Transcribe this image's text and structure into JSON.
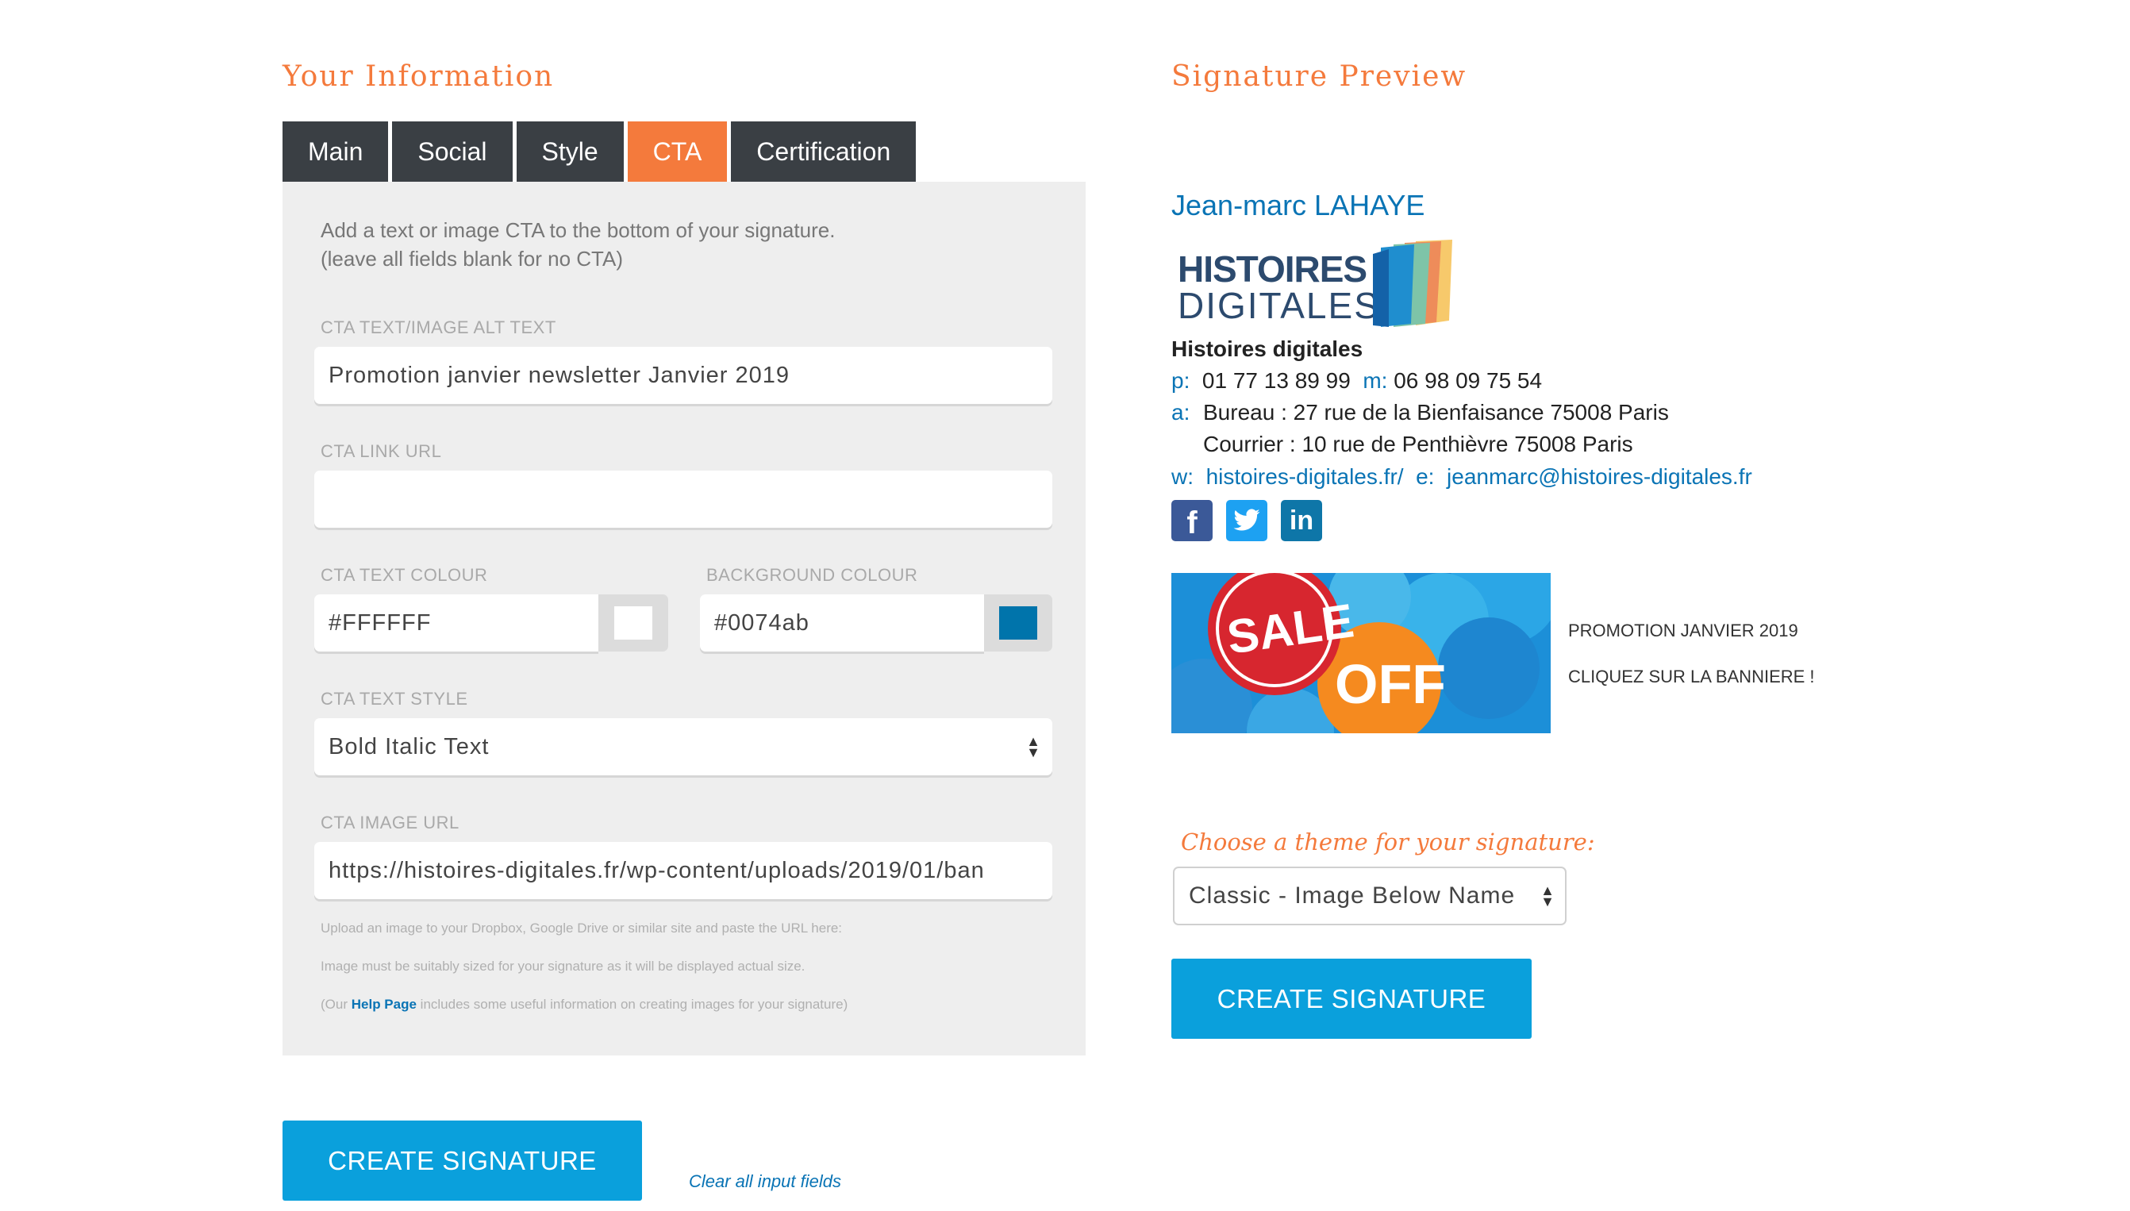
{
  "left": {
    "title": "Your Information",
    "tabs": [
      "Main",
      "Social",
      "Style",
      "CTA",
      "Certification"
    ],
    "active_tab": "CTA",
    "intro_line1": "Add a text or image CTA to the bottom of your signature.",
    "intro_line2": "(leave all fields blank for no CTA)",
    "cta_text": {
      "label": "CTA TEXT/IMAGE ALT TEXT",
      "value": "Promotion janvier newsletter Janvier 2019"
    },
    "cta_link": {
      "label": "CTA LINK URL",
      "value": ""
    },
    "text_colour": {
      "label": "CTA TEXT COLOUR",
      "value": "#FFFFFF",
      "swatch": "#FFFFFF"
    },
    "bg_colour": {
      "label": "BACKGROUND COLOUR",
      "value": "#0074ab",
      "swatch": "#0074ab"
    },
    "text_style": {
      "label": "CTA TEXT STYLE",
      "value": "Bold Italic Text"
    },
    "image_url": {
      "label": "CTA IMAGE URL",
      "value": "https://histoires-digitales.fr/wp-content/uploads/2019/01/ban"
    },
    "help1": "Upload an image to your Dropbox, Google Drive or similar site and paste the URL here:",
    "help2": "Image must be suitably sized for your signature as it will be displayed actual size.",
    "help3_pre": "(Our ",
    "help3_link": "Help Page",
    "help3_post": " includes some useful information on creating images for your signature)",
    "create_button": "CREATE SIGNATURE",
    "clear_link": "Clear all input fields"
  },
  "right": {
    "title": "Signature Preview",
    "name": "Jean-marc LAHAYE",
    "logo_line1": "HISTOIRES",
    "logo_line2": "DIGITALES",
    "company": "Histoires digitales",
    "phone_label": "p:",
    "phone": "01 77 13 89 99",
    "mobile_label": "m:",
    "mobile": "06 98 09 75 54",
    "address_label": "a:",
    "address1": "Bureau : 27 rue de la Bienfaisance 75008 Paris",
    "address2": "Courrier : 10 rue de Penthièvre 75008 Paris",
    "web_label": "w:",
    "web": "histoires-digitales.fr/",
    "email_label": "e:",
    "email": "jeanmarc@histoires-digitales.fr",
    "banner_sale": "SALE",
    "banner_off": "OFF",
    "banner_text1": "PROMOTION JANVIER 2019",
    "banner_text2": "CLIQUEZ SUR LA BANNIERE !",
    "theme_label": "Choose a theme for your signature:",
    "theme_value": "Classic - Image Below Name",
    "create_button": "CREATE SIGNATURE"
  },
  "colors": {
    "accent": "#f47a3c",
    "button": "#0aa0dc",
    "tab": "#3a3f44",
    "link": "#0a74b5"
  }
}
